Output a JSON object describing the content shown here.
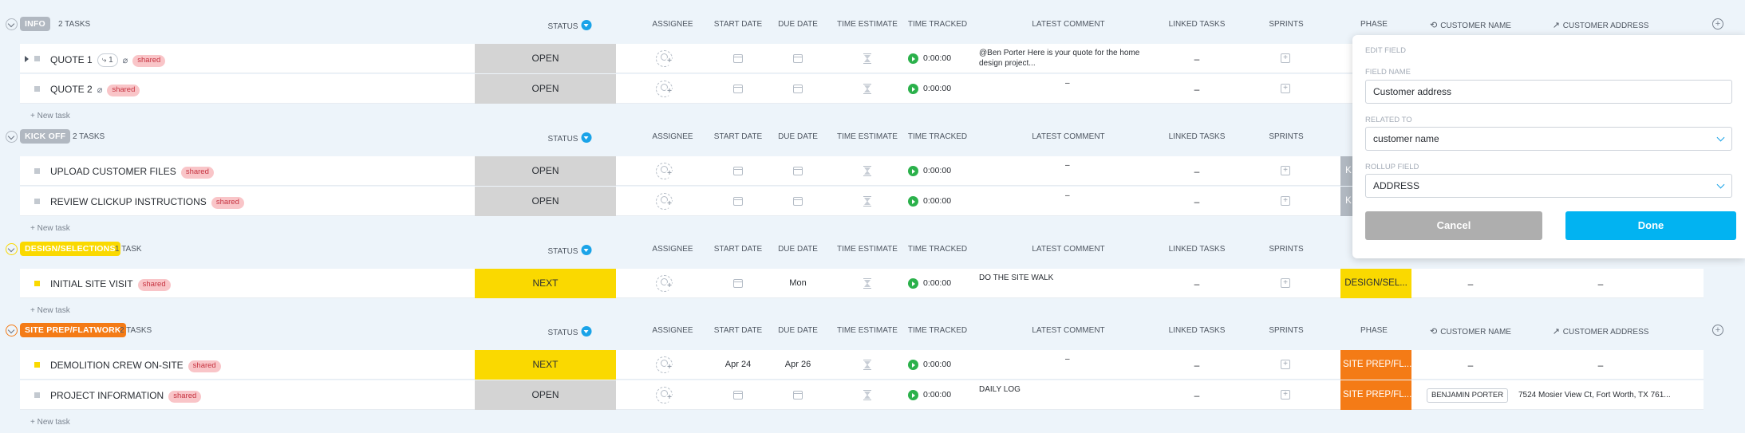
{
  "columns": {
    "status": "STATUS",
    "assignee": "ASSIGNEE",
    "start_date": "START DATE",
    "due_date": "DUE DATE",
    "time_estimate": "TIME ESTIMATE",
    "time_tracked": "TIME TRACKED",
    "latest_comment": "LATEST COMMENT",
    "linked_tasks": "LINKED TASKS",
    "sprints": "SPRINTS",
    "phase": "PHASE",
    "customer_name": "CUSTOMER NAME",
    "customer_address": "CUSTOMER ADDRESS"
  },
  "colors": {
    "info": "#b1b8c1",
    "kickoff": "#b1b8c1",
    "design": "#fad900",
    "siteprep": "#f47b16",
    "status_open": "#d4d4d4",
    "status_next": "#fad900",
    "accent": "#1aa3e8",
    "cancel": "#aeaeae"
  },
  "shared_label": "shared",
  "empty_dash": "–",
  "new_task": "+ New task",
  "groups": [
    {
      "key": "info",
      "name": "INFO",
      "count": "2 TASKS",
      "tasks": [
        {
          "name": "QUOTE 1",
          "subtasks": "1",
          "status": "OPEN",
          "start": "",
          "due": "",
          "tracked": "0:00:00",
          "comment": "@Ben Porter Here is your quote for the home design project...",
          "phase": "",
          "cname": "",
          "addr": ""
        },
        {
          "name": "QUOTE 2",
          "subtasks": "",
          "status": "OPEN",
          "start": "",
          "due": "",
          "tracked": "0:00:00",
          "comment": "–",
          "phase": "",
          "cname": "",
          "addr": ""
        }
      ]
    },
    {
      "key": "kickoff",
      "name": "KICK OFF",
      "count": "2 TASKS",
      "tasks": [
        {
          "name": "UPLOAD CUSTOMER FILES",
          "status": "OPEN",
          "start": "",
          "due": "",
          "tracked": "0:00:00",
          "comment": "–",
          "phase": "K",
          "cname": "",
          "addr": ""
        },
        {
          "name": "REVIEW CLICKUP INSTRUCTIONS",
          "status": "OPEN",
          "start": "",
          "due": "",
          "tracked": "0:00:00",
          "comment": "–",
          "phase": "K",
          "cname": "",
          "addr": ""
        }
      ]
    },
    {
      "key": "design",
      "name": "DESIGN/SELECTIONS",
      "count": "1 TASK",
      "tasks": [
        {
          "name": "INITIAL SITE VISIT",
          "status": "NEXT",
          "start": "",
          "due": "Mon",
          "tracked": "0:00:00",
          "comment": "DO THE SITE WALK",
          "phase": "DESIGN/SEL...",
          "cname": "–",
          "addr": "–"
        }
      ]
    },
    {
      "key": "siteprep",
      "name": "SITE PREP/FLATWORK",
      "count": "2 TASKS",
      "tasks": [
        {
          "name": "DEMOLITION CREW ON-SITE",
          "status": "NEXT",
          "start": "Apr 24",
          "due": "Apr 26",
          "tracked": "0:00:00",
          "comment": "–",
          "phase": "SITE PREP/FL...",
          "cname": "–",
          "addr": "–"
        },
        {
          "name": "PROJECT INFORMATION",
          "status": "OPEN",
          "start": "",
          "due": "",
          "tracked": "0:00:00",
          "comment": "DAILY LOG",
          "phase": "SITE PREP/FL...",
          "cname": "BENJAMIN PORTER",
          "addr": "7524 Mosier View Ct, Fort Worth, TX 761..."
        }
      ]
    }
  ],
  "edit_field": {
    "title": "EDIT FIELD",
    "field_name_label": "FIELD NAME",
    "field_name_value": "Customer address",
    "related_label": "RELATED TO",
    "related_value": "customer name",
    "rollup_label": "ROLLUP FIELD",
    "rollup_value": "ADDRESS",
    "cancel": "Cancel",
    "done": "Done"
  }
}
